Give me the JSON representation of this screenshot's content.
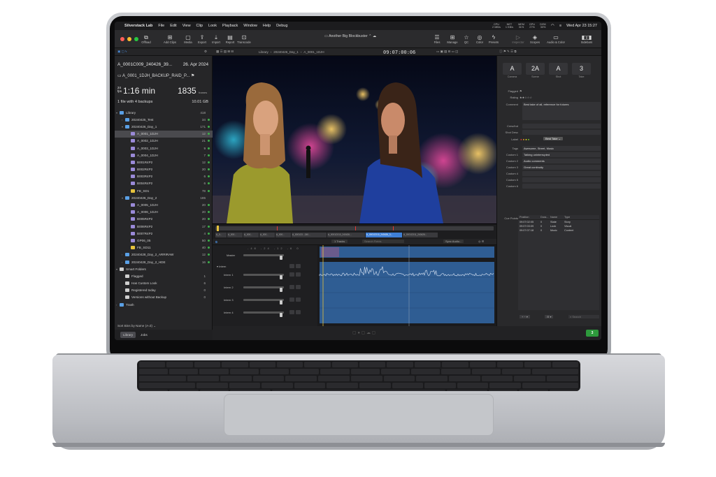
{
  "menubar": {
    "app_name": "Silverstack Lab",
    "menus": [
      "File",
      "Edit",
      "View",
      "Clip",
      "Look",
      "Playback",
      "Window",
      "Help",
      "Debug"
    ],
    "clock": "Wed Apr 23 15:27",
    "stats": [
      {
        "label": "CPU",
        "value": "2 MB/s"
      },
      {
        "label": "NET",
        "value": "1 KB/s"
      },
      {
        "label": "MEM",
        "value": "31%"
      },
      {
        "label": "GPU",
        "value": "27%"
      },
      {
        "label": "DISK",
        "value": "30%"
      }
    ]
  },
  "toolbar": {
    "offload": "Offload",
    "add_clips": "Add Clips",
    "media": "Media",
    "export": "Export",
    "import": "Import",
    "report": "Report",
    "transcode": "Transcode",
    "project_title": "Another Big Blockbuster",
    "files": "Files",
    "manage": "Manage",
    "qc": "QC",
    "color": "Color",
    "presets": "Presets",
    "inspector": "Inspector",
    "scopes": "Scopes",
    "audio_color": "Audio & Color",
    "sidebars": "Sidebars"
  },
  "subbar": {
    "breadcrumb": [
      "Library",
      "20240426_Day_1",
      "A_0001_1DJH"
    ],
    "timecode": "09:07:00:06"
  },
  "sidebar": {
    "clip_name": "A_0001C009_240426_39...",
    "clip_date": "26. Apr 2024",
    "backup_name": "A_0001_1DJH_BACKUP_RAID_P...",
    "duration": "1:16 min",
    "fps": "24",
    "fps_unit": "fps",
    "frames": "1835",
    "frames_unit": "frames",
    "backups_text": "1 file with 4 backups",
    "backups_size": "10.01 GB",
    "tree": [
      {
        "label": "Library",
        "count": "418",
        "icon": "folder",
        "indent": 0,
        "chev": "▾"
      },
      {
        "label": "20240425_Test",
        "count": "34",
        "icon": "folder",
        "indent": 1,
        "chev": "›",
        "dot": true
      },
      {
        "label": "20240426_Day_1",
        "count": "171",
        "icon": "folder",
        "indent": 1,
        "chev": "▾",
        "dot": true
      },
      {
        "label": "A_0001_1DJH",
        "count": "12",
        "icon": "clip",
        "indent": 2,
        "selected": true,
        "dot": true
      },
      {
        "label": "A_0002_1DJH",
        "count": "21",
        "icon": "clip",
        "indent": 2,
        "dot": true
      },
      {
        "label": "A_0003_1DJH",
        "count": "9",
        "icon": "clip",
        "indent": 2,
        "dot": true
      },
      {
        "label": "A_0004_1DJH",
        "count": "7",
        "icon": "clip",
        "indent": 2,
        "dot": true
      },
      {
        "label": "B001R4P2",
        "count": "12",
        "icon": "clip",
        "indent": 2,
        "dot": true
      },
      {
        "label": "B002R4P2",
        "count": "20",
        "icon": "clip",
        "indent": 2,
        "dot": true
      },
      {
        "label": "B003R4P2",
        "count": "6",
        "icon": "clip",
        "indent": 2,
        "dot": true
      },
      {
        "label": "B004R4P2",
        "count": "6",
        "icon": "clip",
        "indent": 2,
        "dot": true
      },
      {
        "label": "FB_SD1",
        "count": "78",
        "icon": "yellow",
        "indent": 2,
        "dot": true
      },
      {
        "label": "20240426_Day_2",
        "count": "185",
        "icon": "folder",
        "indent": 1,
        "chev": "▾"
      },
      {
        "label": "A_0005_1DJH",
        "count": "20",
        "icon": "clip",
        "indent": 2,
        "dot": true
      },
      {
        "label": "A_0006_1DJH",
        "count": "20",
        "icon": "clip",
        "indent": 2,
        "dot": true
      },
      {
        "label": "B005R4P2",
        "count": "20",
        "icon": "clip",
        "indent": 2,
        "dot": true
      },
      {
        "label": "B006R4P2",
        "count": "17",
        "icon": "clip",
        "indent": 2,
        "dot": true
      },
      {
        "label": "B007R4P2",
        "count": "4",
        "icon": "clip",
        "indent": 2,
        "dot": true
      },
      {
        "label": "GP06_05",
        "count": "50",
        "icon": "clip",
        "indent": 2,
        "dot": true
      },
      {
        "label": "FB_SD11",
        "count": "40",
        "icon": "yellow",
        "indent": 2,
        "dot": true
      },
      {
        "label": "20240428_Day_2_ARRIRAW",
        "count": "12",
        "icon": "folder",
        "indent": 1,
        "chev": "›",
        "dot": true
      },
      {
        "label": "20240428_Day_2_HDE",
        "count": "16",
        "icon": "folder",
        "indent": 1,
        "chev": "›",
        "dot": true
      },
      {
        "label": "Smart Folders",
        "count": "",
        "icon": "white",
        "indent": 0,
        "chev": "▾"
      },
      {
        "label": "Flagged",
        "count": "1",
        "icon": "white",
        "indent": 1
      },
      {
        "label": "Has Custom Look",
        "count": "6",
        "icon": "white",
        "indent": 1
      },
      {
        "label": "Registered today",
        "count": "0",
        "icon": "white",
        "indent": 1
      },
      {
        "label": "Versions without Backup",
        "count": "0",
        "icon": "white",
        "indent": 1
      },
      {
        "label": "Trash",
        "count": "",
        "icon": "folder",
        "indent": 0,
        "chev": "›"
      }
    ],
    "sort_label": "Sort Bins by Name (A-Z) ⌄",
    "tab_library": "Library",
    "tab_jobs": "Jobs"
  },
  "filmstrip": {
    "clips": [
      "A_0...",
      "A_000...",
      "A_000...",
      "A_000...",
      "A_000...",
      "A_0001C0...240...",
      "A_0001C010_240426...",
      "A_0001C010_240426_3...",
      "A_0001C011_240426..."
    ],
    "selected_index": 7
  },
  "audio": {
    "tracks_label": "1 Tracks",
    "search_placeholder": "Search Fields",
    "sync_label": "Sync Audio...",
    "master_label": "Master",
    "group_label": "Intern",
    "channels": [
      "Intern 1",
      "Intern 2",
      "Intern 3",
      "Intern 4"
    ],
    "db_ticks": [
      "-48",
      "-24",
      "-12",
      "-6",
      "0"
    ]
  },
  "inspector": {
    "camera": {
      "value": "A",
      "label": "Camera"
    },
    "scene": {
      "value": "2A",
      "label": "Scene"
    },
    "shot": {
      "value": "A",
      "label": "Shot"
    },
    "take": {
      "value": "3",
      "label": "Take"
    },
    "flagged_label": "Flagged",
    "rating_label": "Rating",
    "comment_label": "Comment",
    "comment_value": "Best take of all, reference for futures",
    "crew_label": "Crew/Ind",
    "shot_desc_label": "Shot Desc",
    "label_label": "Label",
    "label_value": "Best Take",
    "tags_label": "Tags",
    "tags_value": "Awesome, Street, Music",
    "custom": [
      {
        "label": "Custom 1",
        "value": "Talking uninterrupted"
      },
      {
        "label": "Custom 2",
        "value": "Audio comments"
      },
      {
        "label": "Custom 3",
        "value": "Great continuity"
      },
      {
        "label": "Custom 4",
        "value": ""
      },
      {
        "label": "Custom 5",
        "value": ""
      },
      {
        "label": "Custom 6",
        "value": ""
      }
    ],
    "cue_points_label": "Cue Points",
    "cue_headers": [
      "Position",
      "Dura...",
      "Name",
      "Type"
    ],
    "cue_rows": [
      {
        "pos": "09:07:02:05",
        "dur": "0",
        "name": "State",
        "type": "Story"
      },
      {
        "pos": "09:07:03:09",
        "dur": "0",
        "name": "Look",
        "type": "Visual"
      },
      {
        "pos": "09:07:07:18",
        "dur": "0",
        "name": "Music",
        "type": "Content"
      }
    ],
    "search_placeholder": "Search"
  },
  "status_badge": "3"
}
